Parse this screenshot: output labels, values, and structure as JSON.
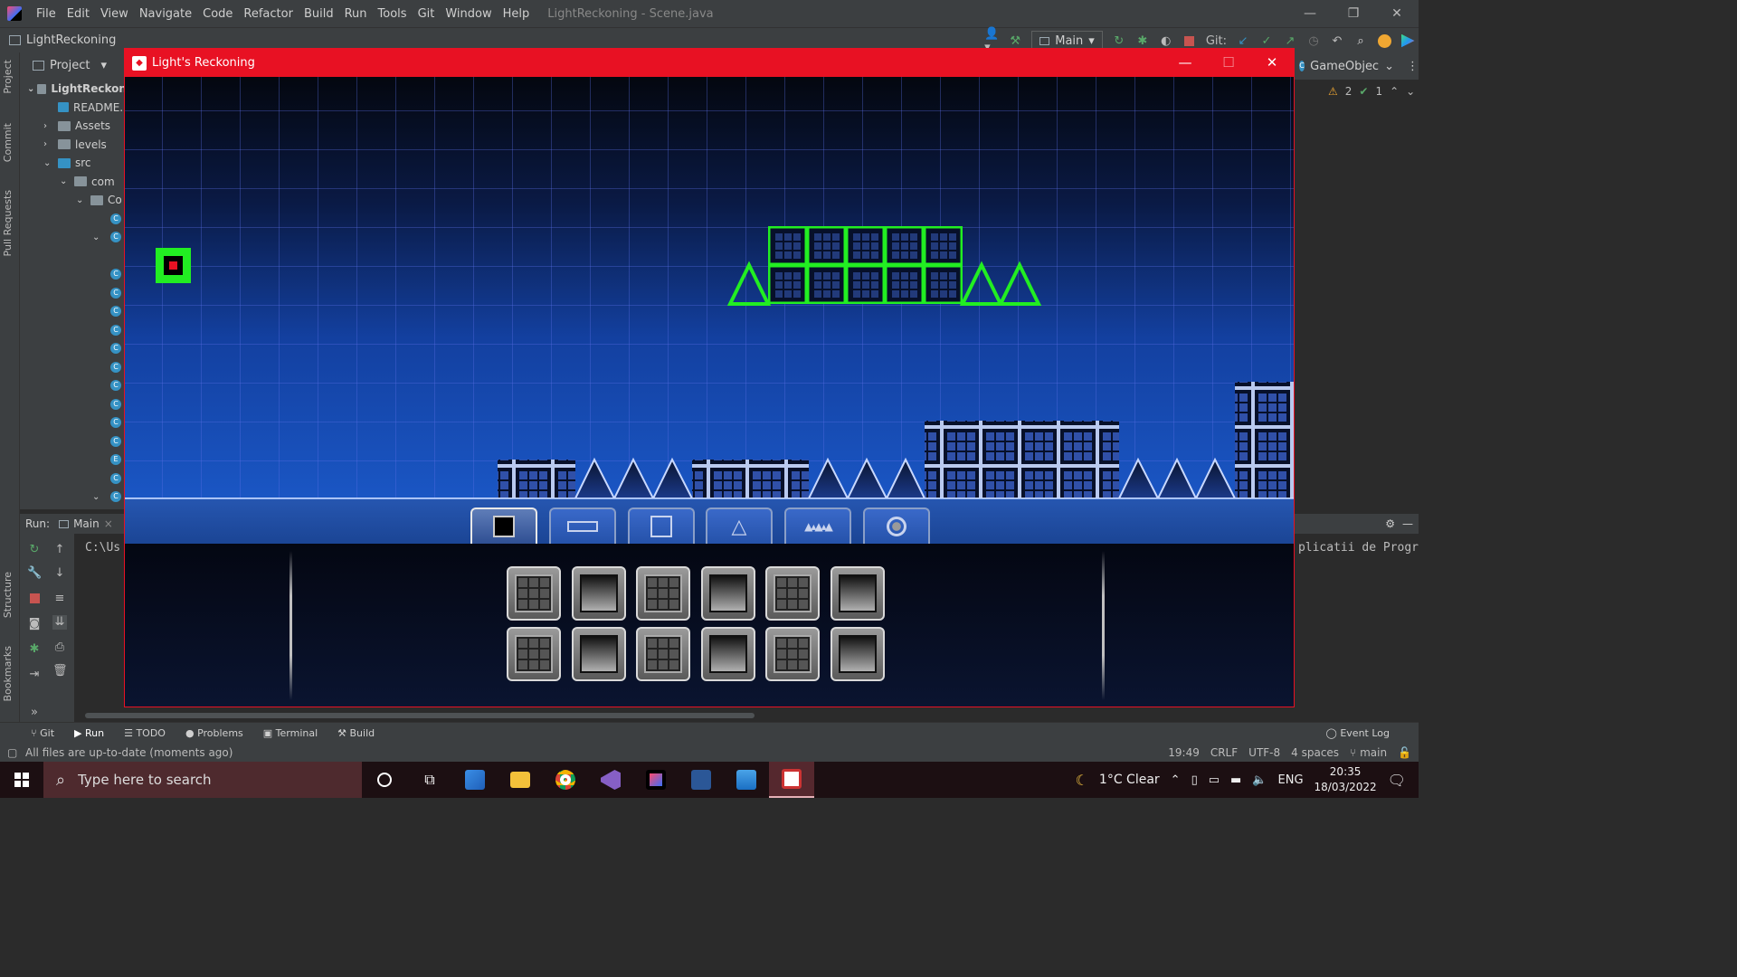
{
  "ide": {
    "menu": [
      "File",
      "Edit",
      "View",
      "Navigate",
      "Code",
      "Refactor",
      "Build",
      "Run",
      "Tools",
      "Git",
      "Window",
      "Help"
    ],
    "window_title": "LightReckoning - Scene.java",
    "project_name": "LightReckoning",
    "run_config": "Main",
    "git_label": "Git:",
    "project_header": "Project",
    "side_tabs": [
      "Project",
      "Commit",
      "Pull Requests"
    ],
    "side_tabs_bottom": [
      "Structure",
      "Bookmarks"
    ],
    "tree": [
      {
        "label": "LightReckon",
        "kind": "project"
      },
      {
        "label": "README.",
        "kind": "file"
      },
      {
        "label": "Assets",
        "kind": "folder"
      },
      {
        "label": "levels",
        "kind": "folder"
      },
      {
        "label": "src",
        "kind": "folder"
      },
      {
        "label": "com",
        "kind": "folder"
      },
      {
        "label": "Co",
        "kind": "folder"
      }
    ],
    "right_panel": {
      "header": "GameObjec",
      "warnings": "2",
      "checks": "1"
    },
    "run_panel": {
      "label": "Run:",
      "tab": "Main",
      "console_left": "C:\\Us",
      "console_right": "plicatii de Progr"
    },
    "bottom_tabs": [
      "Git",
      "Run",
      "TODO",
      "Problems",
      "Terminal",
      "Build",
      "Event Log"
    ],
    "status": {
      "message": "All files are up-to-date (moments ago)",
      "position": "19:49",
      "line_sep": "CRLF",
      "encoding": "UTF-8",
      "indent": "4 spaces",
      "branch": "main"
    }
  },
  "game_window": {
    "title": "Light's Reckoning",
    "controls": {
      "minimize": "—",
      "maximize": "☐",
      "close": "✕"
    }
  },
  "taskbar": {
    "search_placeholder": "Type here to search",
    "weather": "1°C  Clear",
    "language": "ENG",
    "time": "20:35",
    "date": "18/03/2022"
  },
  "colors": {
    "accent_red": "#e81123",
    "player_green": "#22ee22",
    "ide_bg": "#2b2b2b"
  }
}
